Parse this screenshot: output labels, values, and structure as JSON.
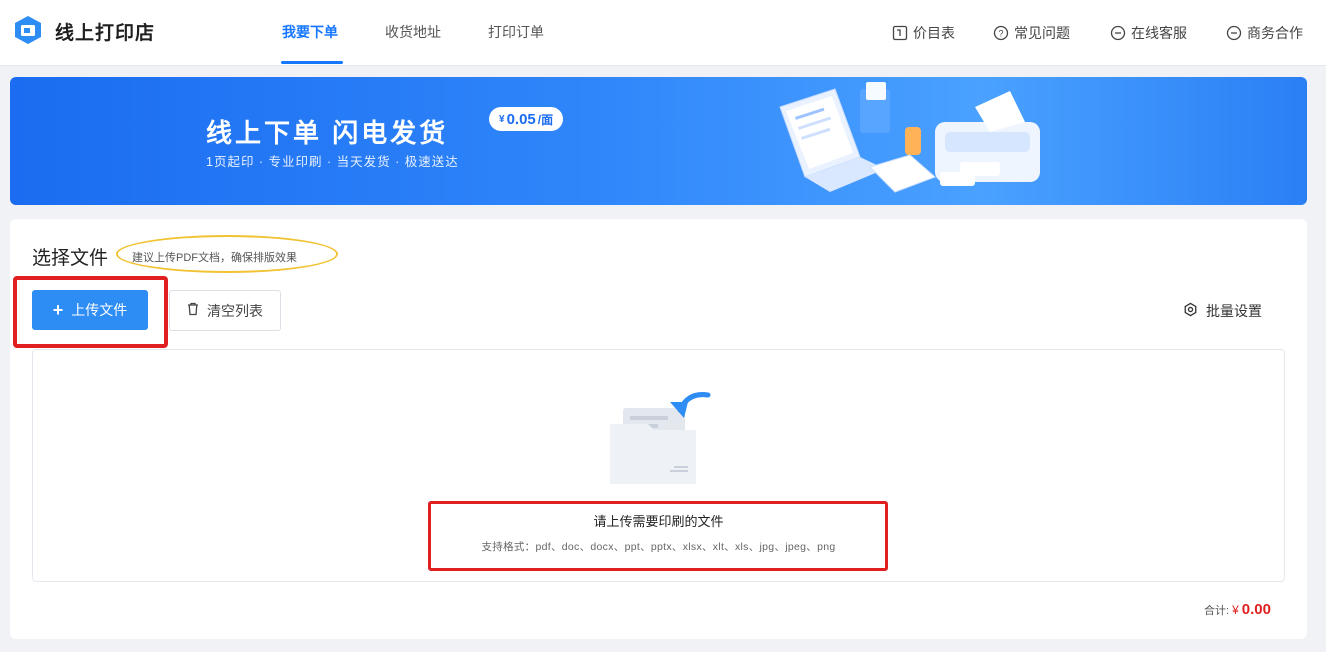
{
  "header": {
    "brand": "线上打印店",
    "tabs": [
      {
        "label": "我要下单",
        "active": true
      },
      {
        "label": "收货地址",
        "active": false
      },
      {
        "label": "打印订单",
        "active": false
      }
    ],
    "links": [
      {
        "label": "价目表",
        "icon": "price-list-icon"
      },
      {
        "label": "常见问题",
        "icon": "question-icon"
      },
      {
        "label": "在线客服",
        "icon": "chat-icon"
      },
      {
        "label": "商务合作",
        "icon": "chat-icon"
      }
    ]
  },
  "banner": {
    "title": "线上下单  闪电发货",
    "subtitle": "1页起印 · 专业印刷 · 当天发货 · 极速送达",
    "price_currency": "¥",
    "price": "0.05",
    "price_unit": "/面"
  },
  "main": {
    "section_title": "选择文件",
    "hint": "建议上传PDF文档，确保排版效果",
    "upload_label": "上传文件",
    "clear_label": "清空列表",
    "batch_label": "批量设置",
    "dropzone_title": "请上传需要印刷的文件",
    "dropzone_formats": "支持格式：pdf、doc、docx、ppt、pptx、xlsx、xlt、xls、jpg、jpeg、png",
    "total_label": "合计:",
    "total_currency": "¥",
    "total_amount": "0.00"
  },
  "colors": {
    "accent": "#1677ff",
    "button": "#2e8cf5",
    "annotation_red": "#e02020",
    "annotation_yellow": "#f1c232"
  }
}
